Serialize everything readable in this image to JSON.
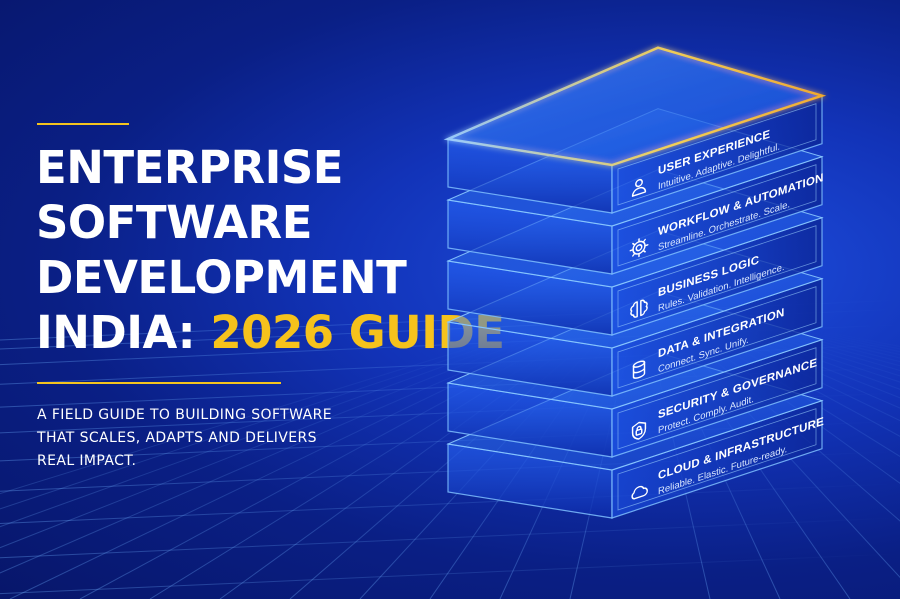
{
  "headline": {
    "line1": "ENTERPRISE",
    "line2": "SOFTWARE",
    "line3": "DEVELOPMENT",
    "line4_prefix": "INDIA: ",
    "line4_accent": "2026 GUIDE"
  },
  "subtitle": {
    "line1": "A FIELD GUIDE TO BUILDING SOFTWARE",
    "line2": "THAT SCALES, ADAPTS AND DELIVERS",
    "line3": "REAL IMPACT."
  },
  "colors": {
    "accent": "#f6c21c",
    "background": "#1233b8",
    "layer_edge": "#5aa8ff",
    "text": "#ffffff"
  },
  "layers": [
    {
      "title": "CLOUD & INFRASTRUCTURE",
      "tagline": "Reliable. Elastic. Future-ready.",
      "icon": "cloud-icon"
    },
    {
      "title": "SECURITY & GOVERNANCE",
      "tagline": "Protect. Comply. Audit.",
      "icon": "shield-lock-icon"
    },
    {
      "title": "DATA & INTEGRATION",
      "tagline": "Connect. Sync. Unify.",
      "icon": "database-icon"
    },
    {
      "title": "BUSINESS LOGIC",
      "tagline": "Rules. Validation. Intelligence.",
      "icon": "brain-icon"
    },
    {
      "title": "WORKFLOW & AUTOMATION",
      "tagline": "Streamline. Orchestrate. Scale.",
      "icon": "gear-icon"
    },
    {
      "title": "USER EXPERIENCE",
      "tagline": "Intuitive. Adaptive. Delightful.",
      "icon": "user-icon"
    }
  ]
}
